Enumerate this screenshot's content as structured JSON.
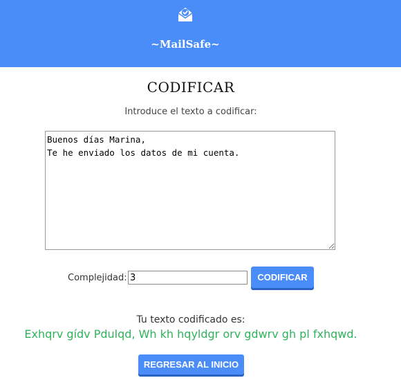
{
  "header": {
    "brand": "~MailSafe~",
    "logo_icon": "envelope-check-icon",
    "background": "#4a8df8"
  },
  "main": {
    "title": "CODIFICAR",
    "prompt": "Introduce el texto a codificar:",
    "input_text": "Buenos días Marina,\nTe he enviado los datos de mi cuenta.",
    "complexity_label": "Complejidad:",
    "complexity_value": "3",
    "encode_button": "CODIFICAR",
    "result_label": "Tu texto codificado es:",
    "result_text": "Exhqrv gídv Pdulqd, Wh kh hqyldgr orv gdwrv gh pl fxhqwd.",
    "result_color": "#2db45a",
    "home_button": "REGRESAR AL INICIO"
  }
}
